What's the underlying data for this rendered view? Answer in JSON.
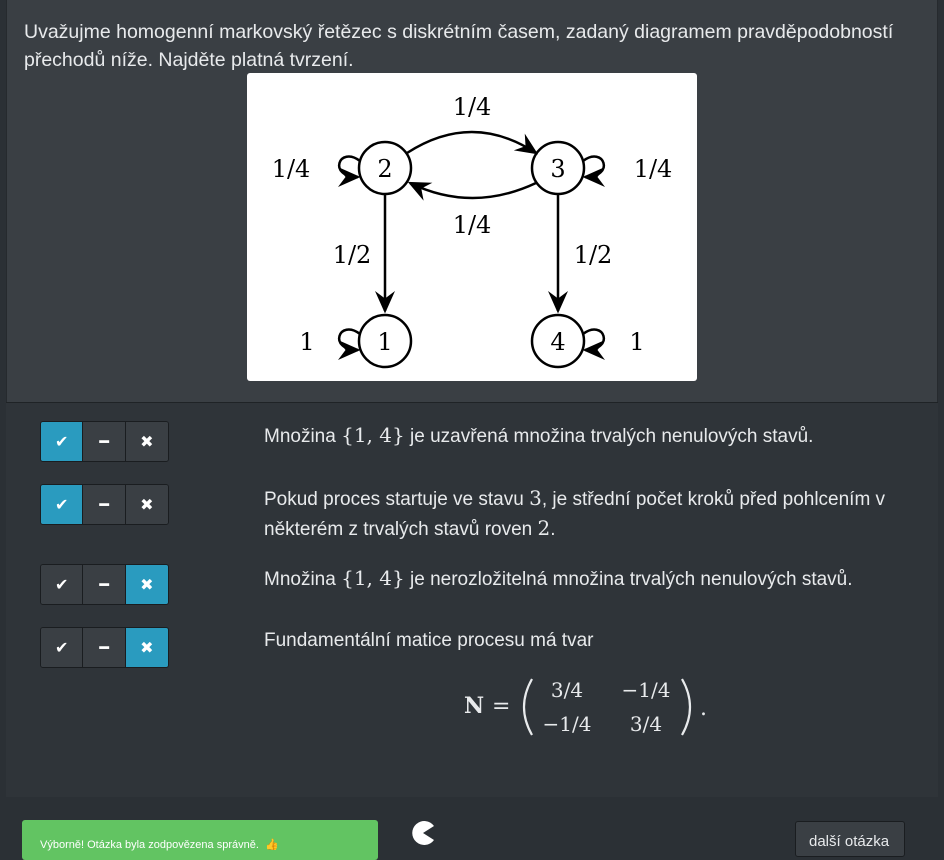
{
  "question": {
    "text": "Uvažujme homogenní markovský řetězec s diskrétním časem, zadaný diagramem pravděpodobností přechodů níže. Najděte platná tvrzení."
  },
  "diagram": {
    "nodes": [
      "1",
      "2",
      "3",
      "4"
    ],
    "labels": {
      "loop_2": "1/4",
      "loop_3": "1/4",
      "edge_2_3": "1/4",
      "edge_3_2": "1/4",
      "edge_2_1": "1/2",
      "edge_3_4": "1/2",
      "loop_1": "1",
      "loop_4": "1"
    }
  },
  "buttons": {
    "yes_icon": "check-icon",
    "neutral_icon": "minus-icon",
    "no_icon": "times-icon"
  },
  "statements": [
    {
      "pre": "Množina ",
      "math": "{1, 4}",
      "post": " je uzavřená množina trvalých nenulových stavů.",
      "selected": "yes"
    },
    {
      "pre": "Pokud proces startuje ve stavu ",
      "math": "3",
      "mid": ", je střední počet kroků před pohlcením v některém z trvalých stavů roven ",
      "math2": "2",
      "post": ".",
      "selected": "yes"
    },
    {
      "pre": "Množina ",
      "math": "{1, 4}",
      "post": " je nerozložitelná množina trvalých nenulových stavů.",
      "selected": "no"
    },
    {
      "pre": "Fundamentální matice procesu má tvar",
      "selected": "no"
    }
  ],
  "matrix": {
    "symbol": "N",
    "equals": "=",
    "cells": [
      "3/4",
      "−1/4",
      "−1/4",
      "3/4"
    ],
    "end": "."
  },
  "footer": {
    "feedback": "Výborně! Otázka byla zodpovězena správně.",
    "next_label": "další otázka"
  },
  "colors": {
    "active": "#2a9bbf",
    "success": "#62c462",
    "panel": "#3a3f44"
  }
}
